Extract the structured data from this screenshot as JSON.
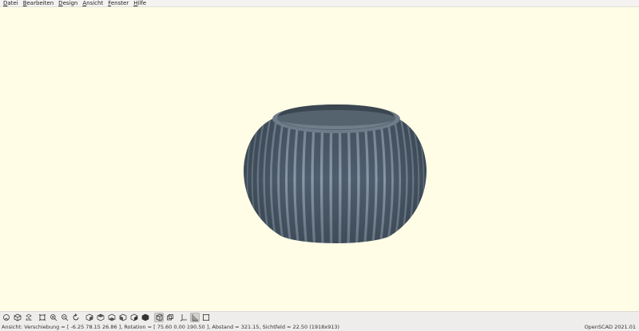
{
  "menu": {
    "items": [
      {
        "hotkey": "D",
        "rest": "atei"
      },
      {
        "hotkey": "B",
        "rest": "earbeiten"
      },
      {
        "hotkey": "D",
        "rest": "esign"
      },
      {
        "hotkey": "A",
        "rest": "nsicht"
      },
      {
        "hotkey": "F",
        "rest": "enster"
      },
      {
        "hotkey": "H",
        "rest": "ilfe"
      }
    ]
  },
  "viewport": {
    "background": "#fffde6",
    "model_color": "#4b5a6a",
    "model": "ribbed-bowl"
  },
  "toolbar": {
    "buttons": [
      {
        "icon": "preview-icon",
        "active": false
      },
      {
        "icon": "render-icon",
        "active": false
      },
      {
        "icon": "export-stl-icon",
        "label": "STL",
        "active": false
      },
      {
        "icon": "view-all-icon",
        "active": false
      },
      {
        "icon": "zoom-in-icon",
        "active": false
      },
      {
        "icon": "zoom-out-icon",
        "active": false
      },
      {
        "icon": "reset-view-icon",
        "active": false
      },
      {
        "icon": "view-right-icon",
        "active": false
      },
      {
        "icon": "view-top-icon",
        "active": false
      },
      {
        "icon": "view-bottom-icon",
        "active": false
      },
      {
        "icon": "view-left-icon",
        "active": false
      },
      {
        "icon": "view-front-icon",
        "active": false
      },
      {
        "icon": "view-back-icon",
        "active": false
      },
      {
        "icon": "perspective-icon",
        "active": true
      },
      {
        "icon": "orthogonal-icon",
        "active": false
      },
      {
        "icon": "show-axes-icon",
        "active": false
      },
      {
        "icon": "show-scale-icon",
        "active": true
      },
      {
        "icon": "show-edges-icon",
        "active": false
      }
    ]
  },
  "status": {
    "left": "Ansicht: Verschiebung = [ -6.25 78.15 26.86 ], Rotation = [ 75.60 0.00 190.50 ], Abstand = 321.15, Sichtfeld = 22.50 (1918x913)",
    "right": "OpenSCAD 2021.01"
  }
}
